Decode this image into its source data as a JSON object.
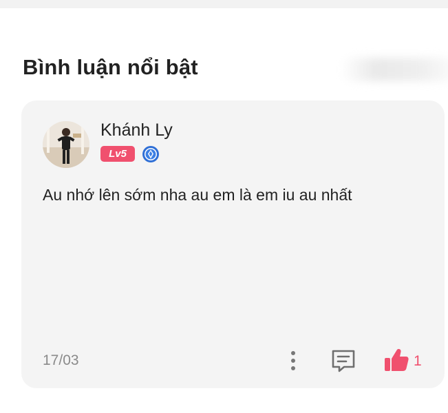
{
  "section": {
    "title": "Bình luận nổi bật"
  },
  "comment": {
    "author": "Khánh Ly",
    "level": "Lv5",
    "text": "Au nhớ lên sớm nha au em là em iu au nhất",
    "date": "17/03",
    "likes": "1"
  },
  "icons": {
    "rank": "blue-diamond-rank-icon",
    "more": "more-vertical-icon",
    "reply": "comment-icon",
    "like": "thumbs-up-icon"
  },
  "colors": {
    "accent": "#f0506e",
    "card_bg": "#f4f4f4",
    "rank_blue": "#2f6fd6"
  }
}
